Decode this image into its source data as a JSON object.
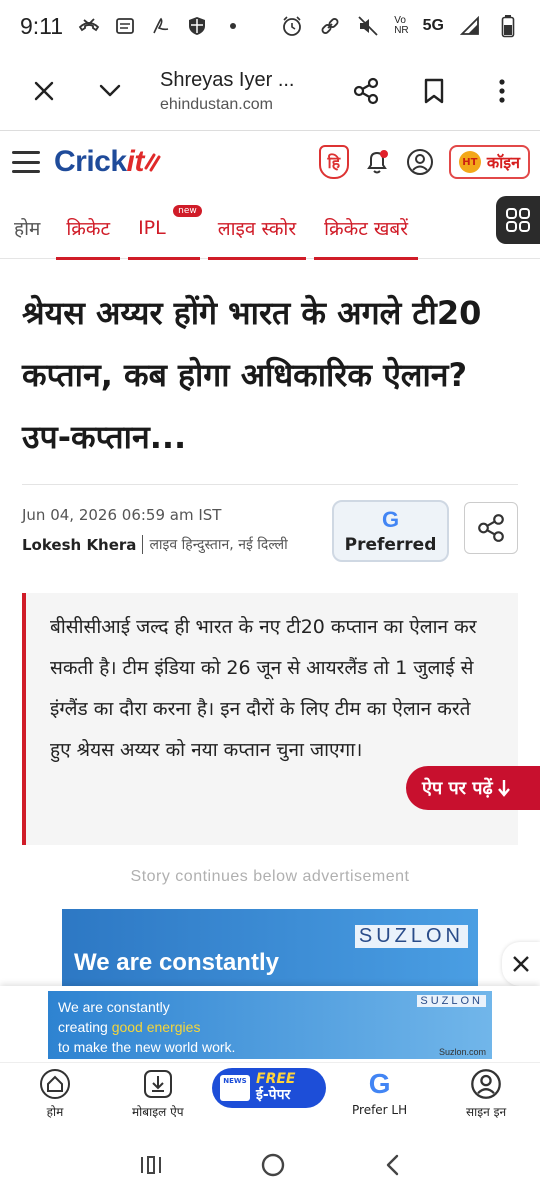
{
  "status_bar": {
    "time": "9:11",
    "network": "5G",
    "volte": "Vo\nNR"
  },
  "toolbar": {
    "page_title": "Shreyas Iyer ...",
    "domain": "ehindustan.com"
  },
  "site": {
    "logo_main": "Crick",
    "logo_suffix": "it",
    "coin_label": "कॉइन",
    "coin_icon_text": "HT"
  },
  "categories": [
    {
      "label": "होम"
    },
    {
      "label": "क्रिकेट"
    },
    {
      "label": "IPL",
      "badge": "new"
    },
    {
      "label": "लाइव स्कोर"
    },
    {
      "label": "क्रिकेट खबरें"
    }
  ],
  "article": {
    "headline": "श्रेयस अय्यर होंगे भारत के अगले टी20 कप्तान, कब होगा अधिकारिक ऐलान? उप-कप्तान...",
    "date": "Jun 04, 2026 06:59 am IST",
    "author": "Lokesh Khera",
    "location": "लाइव हिन्दुस्तान, नई दिल्ली",
    "preferred_g": "G",
    "preferred_label": "Preferred",
    "summary": "बीसीसीआई जल्द ही भारत के नए टी20 कप्तान का ऐलान कर सकती है। टीम इंडिया को 26 जून से आयरलैंड तो 1 जुलाई से इंग्लैंड का दौरा करना है। इन दौरों के लिए टीम का ऐलान करते हुए श्रेयस अय्यर को नया कप्तान चुना जाएगा।",
    "app_button": "ऐप पर पढ़ें"
  },
  "ads": {
    "notice": "Story continues below advertisement",
    "top_brand": "SUZLON",
    "top_text": "We are constantly",
    "bottom_brand": "SUZLON",
    "bottom_line1": "We are constantly",
    "bottom_line2a": "creating ",
    "bottom_line2b": "good energies",
    "bottom_line3": "to make the new world work.",
    "bottom_url": "Suzlon.com"
  },
  "bottom_nav": {
    "home": "होम",
    "mobile_app": "मोबाइल ऐप",
    "epaper_news": "NEWS",
    "epaper_free": "FREE",
    "epaper_label": "ई-पेपर",
    "prefer": "Prefer LH",
    "signin": "साइन इन"
  },
  "colors": {
    "brand_red": "#d01c28",
    "logo_blue": "#1f4b9a",
    "epaper_blue": "#1d4ed8"
  }
}
